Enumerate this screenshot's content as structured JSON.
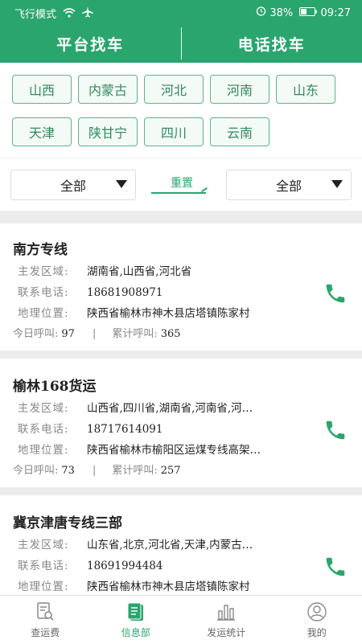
{
  "status": {
    "left_text": "飞行模式",
    "battery": "38%",
    "time": "09:27"
  },
  "tabs": [
    "平台找车",
    "电话找车"
  ],
  "provinces": [
    "山西",
    "内蒙古",
    "河北",
    "河南",
    "山东",
    "天津",
    "陕甘宁",
    "四川",
    "云南"
  ],
  "filters": {
    "left": "全部",
    "reset": "重置",
    "right": "全部"
  },
  "labels": {
    "area": "主发区域:",
    "phone": "联系电话:",
    "address": "地理位置:",
    "today": "今日呼叫:",
    "total": "累计呼叫:",
    "sep": "|"
  },
  "cards": [
    {
      "title": "南方专线",
      "area": "湖南省,山西省,河北省",
      "phone": "18681908971",
      "address": "陕西省榆林市神木县店塔镇陈家村",
      "today": "97",
      "total": "365"
    },
    {
      "title": "榆林168货运",
      "area": "山西省,四川省,湖南省,河南省,河…",
      "phone": "18717614091",
      "address": "陕西省榆林市榆阳区运煤专线高架…",
      "today": "73",
      "total": "257"
    },
    {
      "title": "冀京津唐专线三部",
      "area": "山东省,北京,河北省,天津,内蒙古…",
      "phone": "18691994484",
      "address": "陕西省榆林市神木县店塔镇陈家村"
    }
  ],
  "nav": [
    "查运费",
    "信息部",
    "发运统计",
    "我的"
  ],
  "colors": {
    "primary": "#2aa56e",
    "border": "#5bb58a"
  }
}
